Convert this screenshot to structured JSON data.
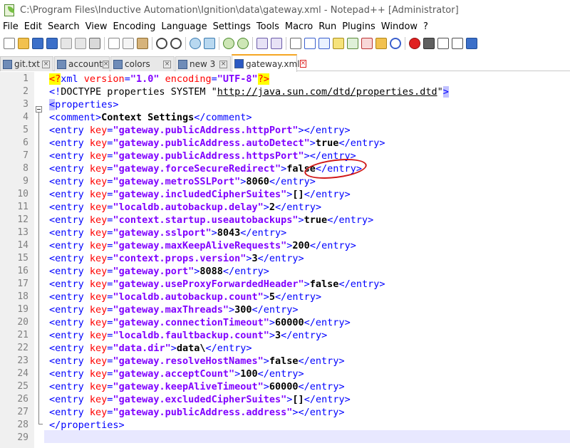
{
  "window": {
    "title": "C:\\Program Files\\Inductive Automation\\Ignition\\data\\gateway.xml - Notepad++ [Administrator]",
    "app_icon": "notepad-plus-plus-icon"
  },
  "menu": {
    "items": [
      "File",
      "Edit",
      "Search",
      "View",
      "Encoding",
      "Language",
      "Settings",
      "Tools",
      "Macro",
      "Run",
      "Plugins",
      "Window",
      "?"
    ]
  },
  "toolbar": {
    "buttons": [
      "new-file-icon",
      "open-file-icon",
      "save-icon",
      "save-all-icon",
      "close-icon",
      "close-all-icon",
      "print-icon",
      "cut-icon",
      "copy-icon",
      "paste-icon",
      "undo-icon",
      "redo-icon",
      "find-icon",
      "replace-icon",
      "zoom-in-icon",
      "zoom-out-icon",
      "sync-vertical-icon",
      "sync-horizontal-icon",
      "word-wrap-icon",
      "show-all-chars-icon",
      "indent-guide-icon",
      "udl-icon",
      "doc-map-icon",
      "function-list-icon",
      "folder-workspace-icon",
      "monitoring-icon",
      "record-macro-icon",
      "stop-macro-icon",
      "play-macro-icon",
      "run-macro-multiple-icon",
      "save-macro-icon"
    ]
  },
  "tabs": [
    {
      "label": "git.txt",
      "active": false
    },
    {
      "label": "account",
      "active": false
    },
    {
      "label": "colors",
      "active": false
    },
    {
      "label": "new 3",
      "active": false
    },
    {
      "label": "gateway.xml",
      "active": true
    }
  ],
  "editor": {
    "line_numbers": [
      "1",
      "2",
      "3",
      "4",
      "5",
      "6",
      "7",
      "8",
      "9",
      "10",
      "11",
      "12",
      "13",
      "14",
      "15",
      "16",
      "17",
      "18",
      "19",
      "20",
      "21",
      "22",
      "23",
      "24",
      "25",
      "26",
      "27",
      "28",
      "29"
    ],
    "lines": [
      [
        [
          "pi",
          "<?"
        ],
        [
          "br",
          "xml "
        ],
        [
          "at",
          "version"
        ],
        [
          "br",
          "="
        ],
        [
          "av",
          "\"1.0\""
        ],
        [
          "br",
          " "
        ],
        [
          "at",
          "encoding"
        ],
        [
          "br",
          "="
        ],
        [
          "av",
          "\"UTF-8\""
        ],
        [
          "pi",
          "?>"
        ]
      ],
      [
        [
          "br",
          "<!"
        ],
        [
          "dt",
          "DOCTYPE properties SYSTEM \""
        ],
        [
          "url",
          "http://java.sun.com/dtd/properties.dtd"
        ],
        [
          "dt",
          "\""
        ],
        [
          "hl",
          ">"
        ]
      ],
      [
        [
          "hl",
          "<"
        ],
        [
          "br",
          "properties>"
        ]
      ],
      [
        [
          "br",
          "<comment>"
        ],
        [
          "tx",
          "Context Settings"
        ],
        [
          "br",
          "</comment>"
        ]
      ],
      [
        [
          "br",
          "<entry "
        ],
        [
          "at",
          "key"
        ],
        [
          "br",
          "="
        ],
        [
          "av",
          "\"gateway.publicAddress.httpPort\""
        ],
        [
          "br",
          "></entry>"
        ]
      ],
      [
        [
          "br",
          "<entry "
        ],
        [
          "at",
          "key"
        ],
        [
          "br",
          "="
        ],
        [
          "av",
          "\"gateway.publicAddress.autoDetect\""
        ],
        [
          "br",
          ">"
        ],
        [
          "tx",
          "true"
        ],
        [
          "br",
          "</entry>"
        ]
      ],
      [
        [
          "br",
          "<entry "
        ],
        [
          "at",
          "key"
        ],
        [
          "br",
          "="
        ],
        [
          "av",
          "\"gateway.publicAddress.httpsPort\""
        ],
        [
          "br",
          "></entry>"
        ]
      ],
      [
        [
          "br",
          "<entry "
        ],
        [
          "at",
          "key"
        ],
        [
          "br",
          "="
        ],
        [
          "av",
          "\"gateway.forceSecureRedirect\""
        ],
        [
          "br",
          ">"
        ],
        [
          "tx",
          "false"
        ],
        [
          "br",
          "</entry>"
        ]
      ],
      [
        [
          "br",
          "<entry "
        ],
        [
          "at",
          "key"
        ],
        [
          "br",
          "="
        ],
        [
          "av",
          "\"gateway.metroSSLPort\""
        ],
        [
          "br",
          ">"
        ],
        [
          "tx",
          "8060"
        ],
        [
          "br",
          "</entry>"
        ]
      ],
      [
        [
          "br",
          "<entry "
        ],
        [
          "at",
          "key"
        ],
        [
          "br",
          "="
        ],
        [
          "av",
          "\"gateway.includedCipherSuites\""
        ],
        [
          "br",
          ">"
        ],
        [
          "tx",
          "[]"
        ],
        [
          "br",
          "</entry>"
        ]
      ],
      [
        [
          "br",
          "<entry "
        ],
        [
          "at",
          "key"
        ],
        [
          "br",
          "="
        ],
        [
          "av",
          "\"localdb.autobackup.delay\""
        ],
        [
          "br",
          ">"
        ],
        [
          "tx",
          "2"
        ],
        [
          "br",
          "</entry>"
        ]
      ],
      [
        [
          "br",
          "<entry "
        ],
        [
          "at",
          "key"
        ],
        [
          "br",
          "="
        ],
        [
          "av",
          "\"context.startup.useautobackups\""
        ],
        [
          "br",
          ">"
        ],
        [
          "tx",
          "true"
        ],
        [
          "br",
          "</entry>"
        ]
      ],
      [
        [
          "br",
          "<entry "
        ],
        [
          "at",
          "key"
        ],
        [
          "br",
          "="
        ],
        [
          "av",
          "\"gateway.sslport\""
        ],
        [
          "br",
          ">"
        ],
        [
          "tx",
          "8043"
        ],
        [
          "br",
          "</entry>"
        ]
      ],
      [
        [
          "br",
          "<entry "
        ],
        [
          "at",
          "key"
        ],
        [
          "br",
          "="
        ],
        [
          "av",
          "\"gateway.maxKeepAliveRequests\""
        ],
        [
          "br",
          ">"
        ],
        [
          "tx",
          "200"
        ],
        [
          "br",
          "</entry>"
        ]
      ],
      [
        [
          "br",
          "<entry "
        ],
        [
          "at",
          "key"
        ],
        [
          "br",
          "="
        ],
        [
          "av",
          "\"context.props.version\""
        ],
        [
          "br",
          ">"
        ],
        [
          "tx",
          "3"
        ],
        [
          "br",
          "</entry>"
        ]
      ],
      [
        [
          "br",
          "<entry "
        ],
        [
          "at",
          "key"
        ],
        [
          "br",
          "="
        ],
        [
          "av",
          "\"gateway.port\""
        ],
        [
          "br",
          ">"
        ],
        [
          "tx",
          "8088"
        ],
        [
          "br",
          "</entry>"
        ]
      ],
      [
        [
          "br",
          "<entry "
        ],
        [
          "at",
          "key"
        ],
        [
          "br",
          "="
        ],
        [
          "av",
          "\"gateway.useProxyForwardedHeader\""
        ],
        [
          "br",
          ">"
        ],
        [
          "tx",
          "false"
        ],
        [
          "br",
          "</entry>"
        ]
      ],
      [
        [
          "br",
          "<entry "
        ],
        [
          "at",
          "key"
        ],
        [
          "br",
          "="
        ],
        [
          "av",
          "\"localdb.autobackup.count\""
        ],
        [
          "br",
          ">"
        ],
        [
          "tx",
          "5"
        ],
        [
          "br",
          "</entry>"
        ]
      ],
      [
        [
          "br",
          "<entry "
        ],
        [
          "at",
          "key"
        ],
        [
          "br",
          "="
        ],
        [
          "av",
          "\"gateway.maxThreads\""
        ],
        [
          "br",
          ">"
        ],
        [
          "tx",
          "300"
        ],
        [
          "br",
          "</entry>"
        ]
      ],
      [
        [
          "br",
          "<entry "
        ],
        [
          "at",
          "key"
        ],
        [
          "br",
          "="
        ],
        [
          "av",
          "\"gateway.connectionTimeout\""
        ],
        [
          "br",
          ">"
        ],
        [
          "tx",
          "60000"
        ],
        [
          "br",
          "</entry>"
        ]
      ],
      [
        [
          "br",
          "<entry "
        ],
        [
          "at",
          "key"
        ],
        [
          "br",
          "="
        ],
        [
          "av",
          "\"localdb.faultbackup.count\""
        ],
        [
          "br",
          ">"
        ],
        [
          "tx",
          "3"
        ],
        [
          "br",
          "</entry>"
        ]
      ],
      [
        [
          "br",
          "<entry "
        ],
        [
          "at",
          "key"
        ],
        [
          "br",
          "="
        ],
        [
          "av",
          "\"data.dir\""
        ],
        [
          "br",
          ">"
        ],
        [
          "tx",
          "data\\"
        ],
        [
          "br",
          "</entry>"
        ]
      ],
      [
        [
          "br",
          "<entry "
        ],
        [
          "at",
          "key"
        ],
        [
          "br",
          "="
        ],
        [
          "av",
          "\"gateway.resolveHostNames\""
        ],
        [
          "br",
          ">"
        ],
        [
          "tx",
          "false"
        ],
        [
          "br",
          "</entry>"
        ]
      ],
      [
        [
          "br",
          "<entry "
        ],
        [
          "at",
          "key"
        ],
        [
          "br",
          "="
        ],
        [
          "av",
          "\"gateway.acceptCount\""
        ],
        [
          "br",
          ">"
        ],
        [
          "tx",
          "100"
        ],
        [
          "br",
          "</entry>"
        ]
      ],
      [
        [
          "br",
          "<entry "
        ],
        [
          "at",
          "key"
        ],
        [
          "br",
          "="
        ],
        [
          "av",
          "\"gateway.keepAliveTimeout\""
        ],
        [
          "br",
          ">"
        ],
        [
          "tx",
          "60000"
        ],
        [
          "br",
          "</entry>"
        ]
      ],
      [
        [
          "br",
          "<entry "
        ],
        [
          "at",
          "key"
        ],
        [
          "br",
          "="
        ],
        [
          "av",
          "\"gateway.excludedCipherSuites\""
        ],
        [
          "br",
          ">"
        ],
        [
          "tx",
          "[]"
        ],
        [
          "br",
          "</entry>"
        ]
      ],
      [
        [
          "br",
          "<entry "
        ],
        [
          "at",
          "key"
        ],
        [
          "br",
          "="
        ],
        [
          "av",
          "\"gateway.publicAddress.address\""
        ],
        [
          "br",
          "></entry>"
        ]
      ],
      [
        [
          "br",
          "</properties>"
        ]
      ],
      []
    ]
  },
  "colors": {
    "tag": "#0000ff",
    "attribute": "#ff0000",
    "attribute_value": "#8000ff",
    "active_tab_accent": "#f5a623",
    "annotation": "#d01818"
  }
}
